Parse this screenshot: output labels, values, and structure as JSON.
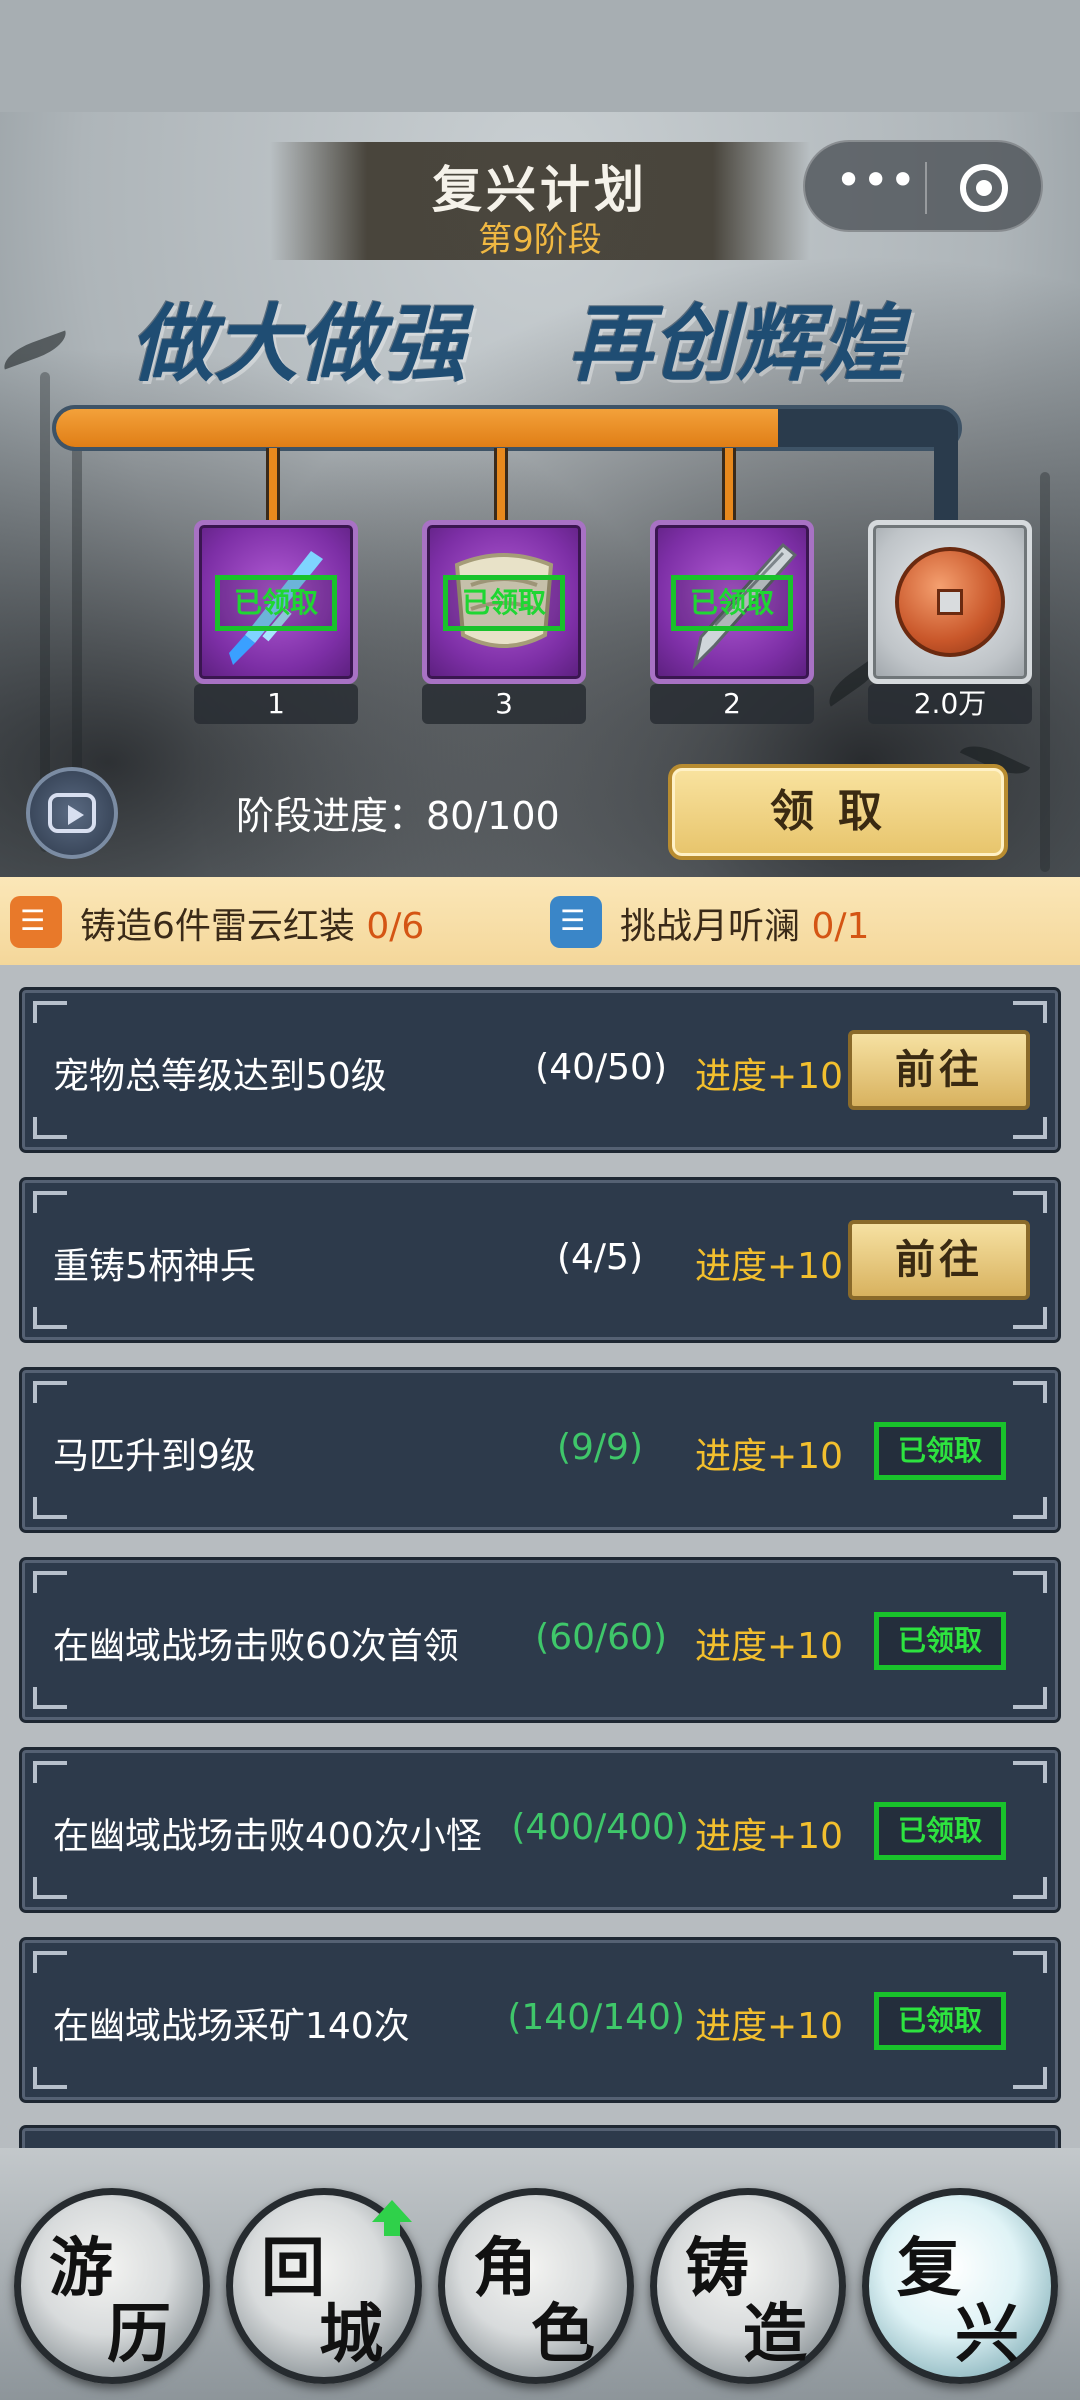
{
  "header": {
    "title": "复兴计划",
    "stage": "第9阶段",
    "slogan_left": "做大做强",
    "slogan_right": "再创辉煌",
    "capsule_more": "•••"
  },
  "progress": {
    "fraction": 0.8,
    "label": "阶段进度：80/100",
    "claim_button": "领取"
  },
  "rewards": [
    {
      "name": "dagger",
      "count": "1",
      "status": "已领取",
      "claimed": true
    },
    {
      "name": "scroll",
      "count": "3",
      "status": "已领取",
      "claimed": true
    },
    {
      "name": "spear-tip",
      "count": "2",
      "status": "已领取",
      "claimed": true
    },
    {
      "name": "copper-coin",
      "count": "2.0万",
      "claimed": false
    }
  ],
  "goals": [
    {
      "text": "铸造6件雷云红装",
      "count": "0/6",
      "color": "#e8792a"
    },
    {
      "text": "挑战月听澜",
      "count": "0/1",
      "color": "#3a86c8"
    }
  ],
  "tasks": [
    {
      "name": "宠物总等级达到50级",
      "count": "(40/50)",
      "reward": "进度+10",
      "action": "前往",
      "done": false
    },
    {
      "name": "重铸5柄神兵",
      "count": "(4/5)",
      "reward": "进度+10",
      "action": "前往",
      "done": false
    },
    {
      "name": "马匹升到9级",
      "count": "(9/9)",
      "reward": "进度+10",
      "action": "已领取",
      "done": true
    },
    {
      "name": "在幽域战场击败60次首领",
      "count": "(60/60)",
      "reward": "进度+10",
      "action": "已领取",
      "done": true
    },
    {
      "name": "在幽域战场击败400次小怪",
      "count": "(400/400)",
      "reward": "进度+10",
      "action": "已领取",
      "done": true
    },
    {
      "name": "在幽域战场采矿140次",
      "count": "(140/140)",
      "reward": "进度+10",
      "action": "已领取",
      "done": true
    }
  ],
  "nav": [
    {
      "c1": "游",
      "c2": "历"
    },
    {
      "c1": "回",
      "c2": "城"
    },
    {
      "c1": "角",
      "c2": "色"
    },
    {
      "c1": "铸",
      "c2": "造"
    },
    {
      "c1": "复",
      "c2": "兴"
    }
  ],
  "colors": {
    "accent_orange": "#e8891d",
    "claimed_green": "#19c22b",
    "reward_yellow": "#f2bf2e",
    "task_bg": "#2d3a4b"
  }
}
